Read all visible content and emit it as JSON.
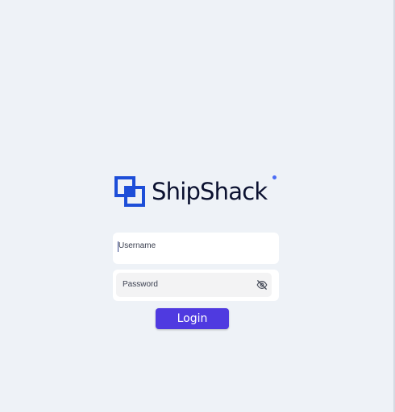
{
  "brand": {
    "name": "ShipShack",
    "logo_color": "#1d4ed8"
  },
  "login_form": {
    "username_placeholder": "Username",
    "password_placeholder": "Password",
    "password_visibility_icon": "eye-off-icon",
    "submit_label": "Login",
    "accent_color": "#4f3ae0"
  }
}
